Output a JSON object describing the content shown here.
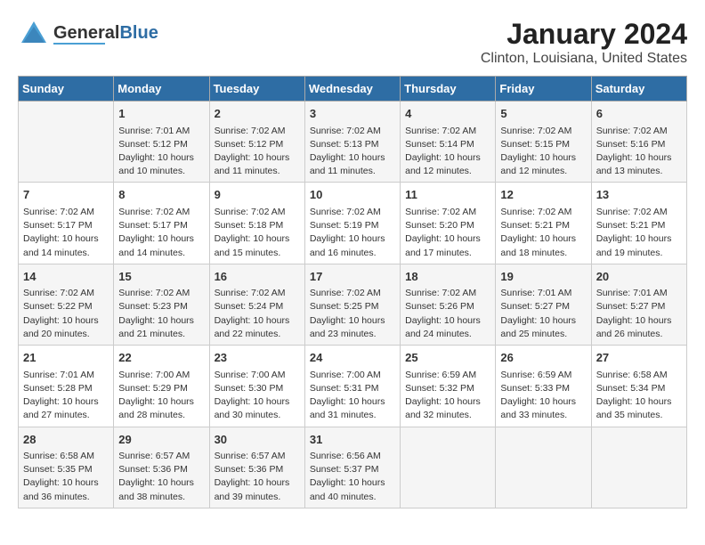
{
  "logo": {
    "general": "General",
    "blue": "Blue"
  },
  "title": "January 2024",
  "subtitle": "Clinton, Louisiana, United States",
  "days_of_week": [
    "Sunday",
    "Monday",
    "Tuesday",
    "Wednesday",
    "Thursday",
    "Friday",
    "Saturday"
  ],
  "weeks": [
    [
      {
        "day": "",
        "sunrise": "",
        "sunset": "",
        "daylight": ""
      },
      {
        "day": "1",
        "sunrise": "Sunrise: 7:01 AM",
        "sunset": "Sunset: 5:12 PM",
        "daylight": "Daylight: 10 hours and 10 minutes."
      },
      {
        "day": "2",
        "sunrise": "Sunrise: 7:02 AM",
        "sunset": "Sunset: 5:12 PM",
        "daylight": "Daylight: 10 hours and 11 minutes."
      },
      {
        "day": "3",
        "sunrise": "Sunrise: 7:02 AM",
        "sunset": "Sunset: 5:13 PM",
        "daylight": "Daylight: 10 hours and 11 minutes."
      },
      {
        "day": "4",
        "sunrise": "Sunrise: 7:02 AM",
        "sunset": "Sunset: 5:14 PM",
        "daylight": "Daylight: 10 hours and 12 minutes."
      },
      {
        "day": "5",
        "sunrise": "Sunrise: 7:02 AM",
        "sunset": "Sunset: 5:15 PM",
        "daylight": "Daylight: 10 hours and 12 minutes."
      },
      {
        "day": "6",
        "sunrise": "Sunrise: 7:02 AM",
        "sunset": "Sunset: 5:16 PM",
        "daylight": "Daylight: 10 hours and 13 minutes."
      }
    ],
    [
      {
        "day": "7",
        "sunrise": "Sunrise: 7:02 AM",
        "sunset": "Sunset: 5:17 PM",
        "daylight": "Daylight: 10 hours and 14 minutes."
      },
      {
        "day": "8",
        "sunrise": "Sunrise: 7:02 AM",
        "sunset": "Sunset: 5:17 PM",
        "daylight": "Daylight: 10 hours and 14 minutes."
      },
      {
        "day": "9",
        "sunrise": "Sunrise: 7:02 AM",
        "sunset": "Sunset: 5:18 PM",
        "daylight": "Daylight: 10 hours and 15 minutes."
      },
      {
        "day": "10",
        "sunrise": "Sunrise: 7:02 AM",
        "sunset": "Sunset: 5:19 PM",
        "daylight": "Daylight: 10 hours and 16 minutes."
      },
      {
        "day": "11",
        "sunrise": "Sunrise: 7:02 AM",
        "sunset": "Sunset: 5:20 PM",
        "daylight": "Daylight: 10 hours and 17 minutes."
      },
      {
        "day": "12",
        "sunrise": "Sunrise: 7:02 AM",
        "sunset": "Sunset: 5:21 PM",
        "daylight": "Daylight: 10 hours and 18 minutes."
      },
      {
        "day": "13",
        "sunrise": "Sunrise: 7:02 AM",
        "sunset": "Sunset: 5:21 PM",
        "daylight": "Daylight: 10 hours and 19 minutes."
      }
    ],
    [
      {
        "day": "14",
        "sunrise": "Sunrise: 7:02 AM",
        "sunset": "Sunset: 5:22 PM",
        "daylight": "Daylight: 10 hours and 20 minutes."
      },
      {
        "day": "15",
        "sunrise": "Sunrise: 7:02 AM",
        "sunset": "Sunset: 5:23 PM",
        "daylight": "Daylight: 10 hours and 21 minutes."
      },
      {
        "day": "16",
        "sunrise": "Sunrise: 7:02 AM",
        "sunset": "Sunset: 5:24 PM",
        "daylight": "Daylight: 10 hours and 22 minutes."
      },
      {
        "day": "17",
        "sunrise": "Sunrise: 7:02 AM",
        "sunset": "Sunset: 5:25 PM",
        "daylight": "Daylight: 10 hours and 23 minutes."
      },
      {
        "day": "18",
        "sunrise": "Sunrise: 7:02 AM",
        "sunset": "Sunset: 5:26 PM",
        "daylight": "Daylight: 10 hours and 24 minutes."
      },
      {
        "day": "19",
        "sunrise": "Sunrise: 7:01 AM",
        "sunset": "Sunset: 5:27 PM",
        "daylight": "Daylight: 10 hours and 25 minutes."
      },
      {
        "day": "20",
        "sunrise": "Sunrise: 7:01 AM",
        "sunset": "Sunset: 5:27 PM",
        "daylight": "Daylight: 10 hours and 26 minutes."
      }
    ],
    [
      {
        "day": "21",
        "sunrise": "Sunrise: 7:01 AM",
        "sunset": "Sunset: 5:28 PM",
        "daylight": "Daylight: 10 hours and 27 minutes."
      },
      {
        "day": "22",
        "sunrise": "Sunrise: 7:00 AM",
        "sunset": "Sunset: 5:29 PM",
        "daylight": "Daylight: 10 hours and 28 minutes."
      },
      {
        "day": "23",
        "sunrise": "Sunrise: 7:00 AM",
        "sunset": "Sunset: 5:30 PM",
        "daylight": "Daylight: 10 hours and 30 minutes."
      },
      {
        "day": "24",
        "sunrise": "Sunrise: 7:00 AM",
        "sunset": "Sunset: 5:31 PM",
        "daylight": "Daylight: 10 hours and 31 minutes."
      },
      {
        "day": "25",
        "sunrise": "Sunrise: 6:59 AM",
        "sunset": "Sunset: 5:32 PM",
        "daylight": "Daylight: 10 hours and 32 minutes."
      },
      {
        "day": "26",
        "sunrise": "Sunrise: 6:59 AM",
        "sunset": "Sunset: 5:33 PM",
        "daylight": "Daylight: 10 hours and 33 minutes."
      },
      {
        "day": "27",
        "sunrise": "Sunrise: 6:58 AM",
        "sunset": "Sunset: 5:34 PM",
        "daylight": "Daylight: 10 hours and 35 minutes."
      }
    ],
    [
      {
        "day": "28",
        "sunrise": "Sunrise: 6:58 AM",
        "sunset": "Sunset: 5:35 PM",
        "daylight": "Daylight: 10 hours and 36 minutes."
      },
      {
        "day": "29",
        "sunrise": "Sunrise: 6:57 AM",
        "sunset": "Sunset: 5:36 PM",
        "daylight": "Daylight: 10 hours and 38 minutes."
      },
      {
        "day": "30",
        "sunrise": "Sunrise: 6:57 AM",
        "sunset": "Sunset: 5:36 PM",
        "daylight": "Daylight: 10 hours and 39 minutes."
      },
      {
        "day": "31",
        "sunrise": "Sunrise: 6:56 AM",
        "sunset": "Sunset: 5:37 PM",
        "daylight": "Daylight: 10 hours and 40 minutes."
      },
      {
        "day": "",
        "sunrise": "",
        "sunset": "",
        "daylight": ""
      },
      {
        "day": "",
        "sunrise": "",
        "sunset": "",
        "daylight": ""
      },
      {
        "day": "",
        "sunrise": "",
        "sunset": "",
        "daylight": ""
      }
    ]
  ]
}
